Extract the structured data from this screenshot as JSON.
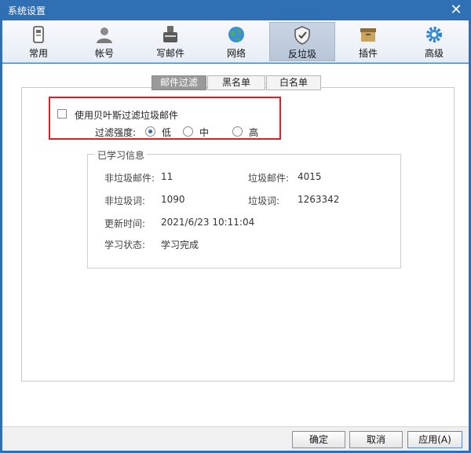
{
  "window": {
    "title": "系统设置"
  },
  "toolbar": {
    "items": [
      {
        "label": "常用",
        "icon": "general-icon"
      },
      {
        "label": "帐号",
        "icon": "account-icon"
      },
      {
        "label": "写邮件",
        "icon": "compose-icon"
      },
      {
        "label": "网络",
        "icon": "network-icon"
      },
      {
        "label": "反垃圾",
        "icon": "antispam-shield-icon",
        "active": true
      },
      {
        "label": "插件",
        "icon": "plugin-box-icon"
      },
      {
        "label": "高级",
        "icon": "advanced-gear-icon"
      }
    ]
  },
  "tabs": [
    {
      "label": "邮件过滤",
      "active": true
    },
    {
      "label": "黑名单"
    },
    {
      "label": "白名单"
    }
  ],
  "filter": {
    "bayes_label": "使用贝叶斯过滤垃圾邮件",
    "bayes_checked": false,
    "strength_label": "过滤强度:",
    "options": [
      {
        "label": "低",
        "checked": true
      },
      {
        "label": "中",
        "checked": false
      },
      {
        "label": "高",
        "checked": false
      }
    ]
  },
  "learned": {
    "title": "已学习信息",
    "non_spam_mail_label": "非垃圾邮件:",
    "non_spam_mail_value": "11",
    "spam_mail_label": "垃圾邮件:",
    "spam_mail_value": "4015",
    "non_spam_word_label": "非垃圾词:",
    "non_spam_word_value": "1090",
    "spam_word_label": "垃圾词:",
    "spam_word_value": "1263342",
    "update_time_label": "更新时间:",
    "update_time_value": "2021/6/23 10:11:04",
    "status_label": "学习状态:",
    "status_value": "学习完成"
  },
  "buttons": {
    "ok": "确定",
    "cancel": "取消",
    "apply": "应用(A)"
  },
  "colors": {
    "titlebar": "#2f6fb3",
    "highlight": "#e02020"
  }
}
